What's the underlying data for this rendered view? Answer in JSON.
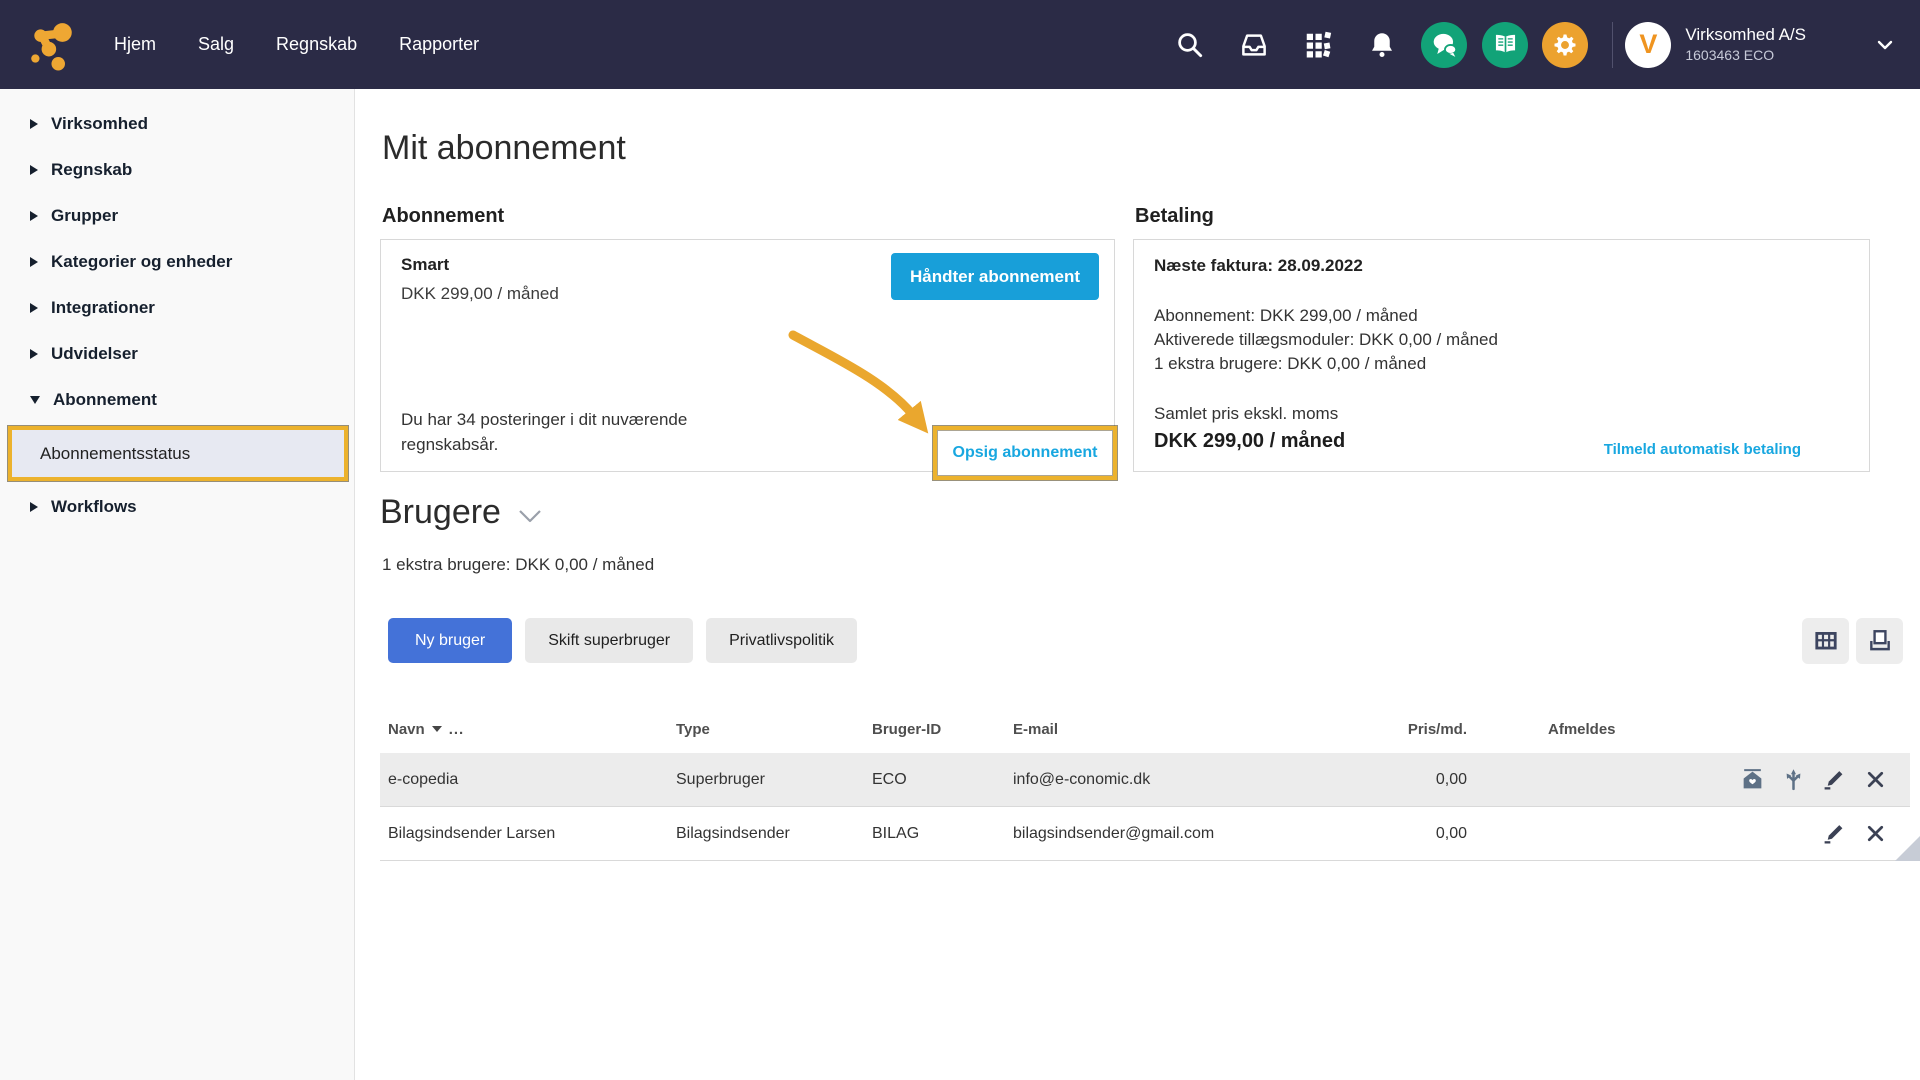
{
  "topbar": {
    "nav": [
      "Hjem",
      "Salg",
      "Regnskab",
      "Rapporter"
    ],
    "company": {
      "name": "Virksomhed A/S",
      "id": "1603463 ECO"
    }
  },
  "sidebar": {
    "items": [
      "Virksomhed",
      "Regnskab",
      "Grupper",
      "Kategorier og enheder",
      "Integrationer",
      "Udvidelser",
      "Abonnement",
      "Workflows"
    ],
    "subitem": "Abonnementsstatus"
  },
  "page": {
    "title": "Mit abonnement"
  },
  "subscription": {
    "section_title": "Abonnement",
    "plan_name": "Smart",
    "plan_price": "DKK 299,00 / måned",
    "manage_button": "Håndter abonnement",
    "postings_line1": "Du har 34 posteringer i dit nuværende",
    "postings_line2": "regnskabsår.",
    "cancel_link": "Opsig abonnement"
  },
  "payment": {
    "section_title": "Betaling",
    "next_invoice": "Næste faktura: 28.09.2022",
    "lines": [
      "Abonnement: DKK 299,00 / måned",
      "Aktiverede tillægsmoduler: DKK 0,00 / måned",
      "1 ekstra brugere: DKK 0,00 / måned"
    ],
    "total_label": "Samlet pris ekskl. moms",
    "total_value": "DKK 299,00 / måned",
    "autopay_link": "Tilmeld automatisk betaling"
  },
  "users": {
    "section_title": "Brugere",
    "extra_users_line": "1 ekstra brugere: DKK 0,00 / måned",
    "buttons": [
      "Ny bruger",
      "Skift superbruger",
      "Privatlivspolitik"
    ],
    "table": {
      "headers": {
        "name": "Navn",
        "more": "...",
        "type": "Type",
        "user_id": "Bruger-ID",
        "email": "E-mail",
        "price": "Pris/md.",
        "unsubscribe": "Afmeldes"
      },
      "rows": [
        {
          "name": "e-copedia",
          "type": "Superbruger",
          "user_id": "ECO",
          "email": "info@e-conomic.dk",
          "price": "0,00"
        },
        {
          "name": "Bilagsindsender Larsen",
          "type": "Bilagsindsender",
          "user_id": "BILAG",
          "email": "bilagsindsender@gmail.com",
          "price": "0,00"
        }
      ]
    }
  },
  "icons": {
    "topbar": [
      "search",
      "inbox",
      "apps",
      "notifications",
      "chat",
      "help-book",
      "settings",
      "chevron-down"
    ],
    "table_tools": [
      "grid-view",
      "print"
    ],
    "row_actions": [
      "home",
      "branch",
      "edit",
      "delete"
    ]
  },
  "colors": {
    "topbar_bg": "#2b2b46",
    "highlight_gold": "#ecb22d",
    "manage_button_blue": "#189fd9",
    "primary_button_blue": "#4472d8",
    "link_cyan": "#18a7e0",
    "icon_green": "#12a378",
    "icon_orange": "#eca22f",
    "active_item_bg": "#e7e9f2",
    "row_alt_bg": "#ececec"
  }
}
